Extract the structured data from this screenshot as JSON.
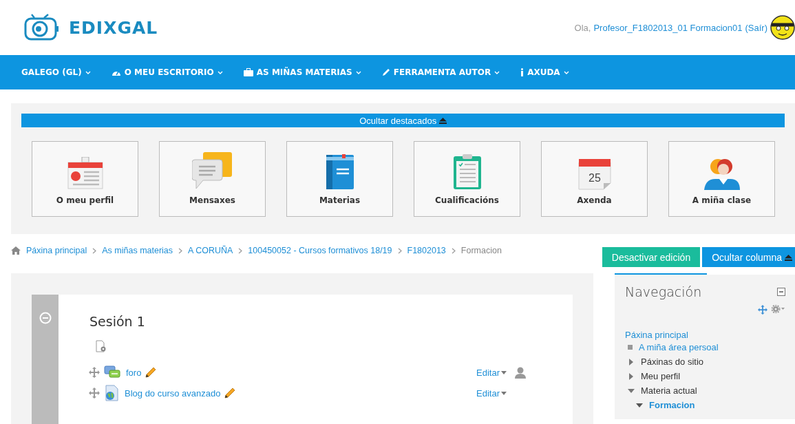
{
  "header": {
    "logo_text": "EDIXGAL",
    "greeting": "Ola,",
    "user_name": "Profesor_F1802013_01 Formacion01",
    "logout": "(Saír)"
  },
  "nav_menu": [
    {
      "label": "GALEGO (GL)",
      "kind": "plain"
    },
    {
      "label": "O MEU ESCRITORIO",
      "kind": "dashboard"
    },
    {
      "label": "AS MIÑAS MATERIAS",
      "kind": "subjects"
    },
    {
      "label": "FERRAMENTA AUTOR",
      "kind": "author"
    },
    {
      "label": "AXUDA",
      "kind": "help"
    }
  ],
  "highlights": {
    "toggle": "Ocultar destacados",
    "tiles": [
      {
        "label": "O meu perfil",
        "kind": "profile"
      },
      {
        "label": "Mensaxes",
        "kind": "messages"
      },
      {
        "label": "Materias",
        "kind": "book"
      },
      {
        "label": "Cualificacións",
        "kind": "grades"
      },
      {
        "label": "Axenda",
        "kind": "calendar",
        "day": "25"
      },
      {
        "label": "A miña clase",
        "kind": "class"
      }
    ]
  },
  "breadcrumb": [
    {
      "label": "Páxina principal",
      "current": false
    },
    {
      "label": "As miñas materias",
      "current": false
    },
    {
      "label": "A CORUÑA",
      "current": false
    },
    {
      "label": "100450052 - Cursos formativos 18/19",
      "current": false
    },
    {
      "label": "F1802013",
      "current": false
    },
    {
      "label": "Formacion",
      "current": true
    }
  ],
  "buttons": {
    "edit_mode": "Desactivar edición",
    "hide_column": "Ocultar columna"
  },
  "section": {
    "title": "Sesión 1",
    "activities": [
      {
        "name": "foro",
        "kind": "forum",
        "edit": "Editar",
        "roles_icon": true
      },
      {
        "name": "Blog do curso avanzado",
        "kind": "blog",
        "edit": "Editar",
        "roles_icon": false
      }
    ]
  },
  "navigation": {
    "title": "Navegación",
    "home": "Páxina principal",
    "items": [
      {
        "label": "A miña área persoal",
        "kind": "leaf",
        "link": true
      },
      {
        "label": "Páxinas do sitio",
        "kind": "branch",
        "link": false,
        "expanded": false
      },
      {
        "label": "Meu perfil",
        "kind": "branch",
        "link": false,
        "expanded": false
      },
      {
        "label": "Materia actual",
        "kind": "branch",
        "link": false,
        "expanded": true,
        "children": [
          {
            "label": "Formacion",
            "kind": "branch",
            "link": true,
            "expanded": true
          }
        ]
      }
    ]
  }
}
